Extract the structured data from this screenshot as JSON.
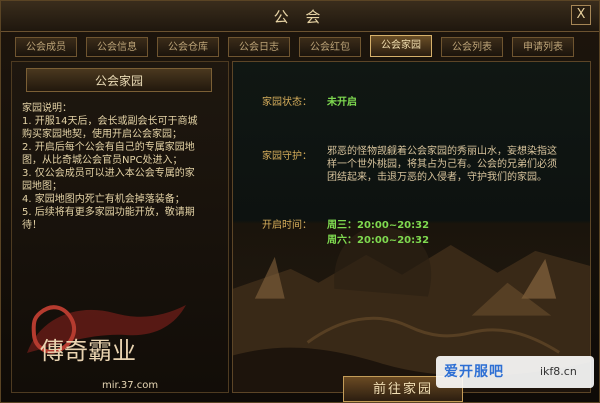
{
  "window": {
    "title": "公 会",
    "close_label": "X"
  },
  "tabs": [
    {
      "label": "公会成员"
    },
    {
      "label": "公会信息"
    },
    {
      "label": "公会仓库"
    },
    {
      "label": "公会日志"
    },
    {
      "label": "公会红包"
    },
    {
      "label": "公会家园"
    },
    {
      "label": "公会列表"
    },
    {
      "label": "申请列表"
    }
  ],
  "left": {
    "header": "公会家园",
    "notes": [
      "家园说明：",
      "1. 开服14天后，会长或副会长可于商城",
      "购买家园地契，使用开启公会家园；",
      "2. 开启后每个公会有自己的专属家园地",
      "图，从比奇城公会官员NPC处进入；",
      "3. 仅公会成员可以进入本公会专属的家",
      "园地图；",
      "4. 家园地图内死亡有机会掉落装备；",
      "5. 后续将有更多家园功能开放，敬请期",
      "待！"
    ],
    "logo_text": "傳奇霸业",
    "logo_url": "mir.37.com"
  },
  "right": {
    "status_label": "家园状态：",
    "status_value": "未开启",
    "guard_label": "家园守护：",
    "guard_lines": [
      "邪恶的怪物觊觎着公会家园的秀丽山水，妄想染指这",
      "样一个世外桃园，将其占为己有。公会的兄弟们必须",
      "团结起来，击退万恶的入侵者，守护我们的家园。"
    ],
    "open_label": "开启时间：",
    "open_times": [
      "周三：20:00~20:32",
      "周六：20:00~20:32"
    ],
    "go_button": "前往家园"
  },
  "watermark": {
    "left": "爱开服吧",
    "right": "ikf8.cn"
  }
}
